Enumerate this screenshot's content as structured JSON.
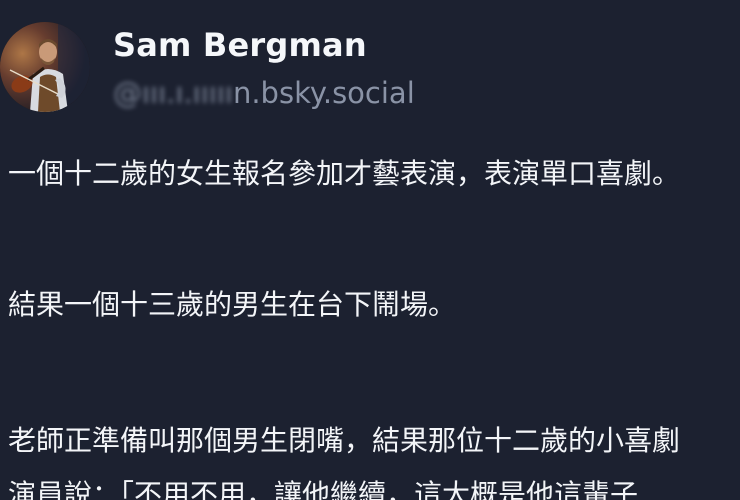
{
  "post": {
    "author": {
      "display_name": "Sam Bergman",
      "handle_prefix": "@ııı.ı.ııııı",
      "handle_suffix": "n.bsky.social",
      "avatar_icon": "user-avatar-photo"
    },
    "paragraphs": [
      "一個十二歲的女生報名參加才藝表演，表演單口喜劇。",
      "結果一個十三歲的男生在台下鬧場。",
      "老師正準備叫那個男生閉嘴，結果那位十二歲的小喜劇",
      "演員說：「不用不用，讓他繼續，這大概是他這輩子"
    ]
  },
  "colors": {
    "background": "#1c2130",
    "text": "#f3f5f8",
    "handle": "#8a93a6"
  }
}
